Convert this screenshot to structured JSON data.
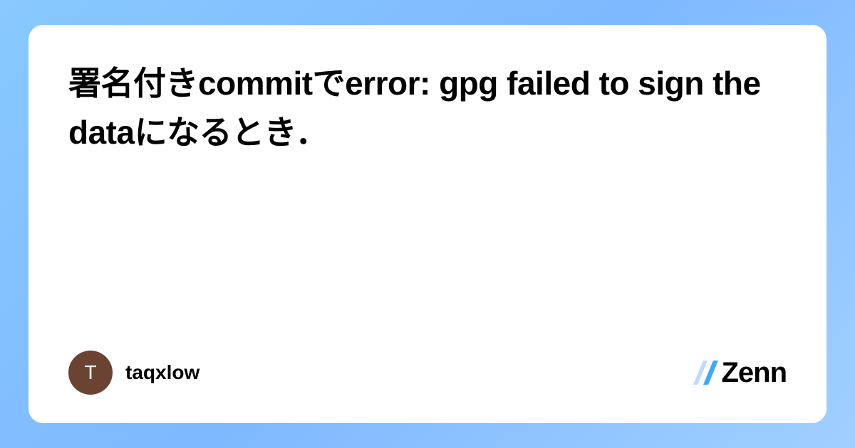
{
  "article": {
    "title": "署名付きcommitでerror: gpg failed to sign the dataになるとき．"
  },
  "author": {
    "username": "taqxlow",
    "avatar_initial": "T"
  },
  "platform": {
    "name": "Zenn"
  }
}
